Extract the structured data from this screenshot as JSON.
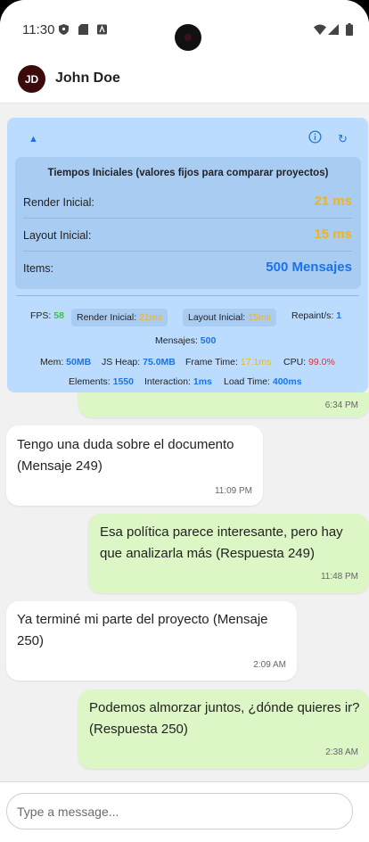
{
  "status_bar": {
    "time": "11:30",
    "icons": [
      "shield-icon",
      "sd-card-icon",
      "app-notification-icon",
      "wifi-icon",
      "signal-icon",
      "battery-icon"
    ]
  },
  "header": {
    "avatar_initials": "JD",
    "avatar_color": "#3c0a0a",
    "contact_name": "John Doe"
  },
  "perf_panel": {
    "collapse_icon": "▲",
    "info_icon": "info-icon",
    "refresh_icon": "↻",
    "initial_times": {
      "title": "Tiempos Iniciales (valores fijos para comparar proyectos)",
      "rows": [
        {
          "label": "Render Inicial:",
          "value": "21 ms"
        },
        {
          "label": "Layout Inicial:",
          "value": "15 ms"
        },
        {
          "label": "Items:",
          "value": "500 Mensajes"
        }
      ]
    },
    "stats": {
      "fps_label": "FPS:",
      "fps_value": "58",
      "render_label": "Render Inicial:",
      "render_value": "21ms",
      "layout_label": "Layout Inicial:",
      "layout_value": "15ms",
      "repaint_label": "Repaint/s:",
      "repaint_value": "1",
      "messages_label": "Mensajes:",
      "messages_value": "500",
      "mem_label": "Mem:",
      "mem_value": "50MB",
      "heap_label": "JS Heap:",
      "heap_value": "75.0MB",
      "frame_label": "Frame Time:",
      "frame_value": "17.1ms",
      "cpu_label": "CPU:",
      "cpu_value": "99.0%",
      "elements_label": "Elements:",
      "elements_value": "1550",
      "interaction_label": "Interaction:",
      "interaction_value": "1ms",
      "load_label": "Load Time:",
      "load_value": "400ms"
    },
    "colors": {
      "panel": "#bcdcff",
      "good": "#3fbf4a",
      "warn": "#f2b417",
      "info": "#1a73e8",
      "bad": "#e03030"
    }
  },
  "messages": [
    {
      "type": "outgoing",
      "text": "",
      "time": "6:34 PM"
    },
    {
      "type": "incoming",
      "text": "Tengo una duda sobre el documento (Mensaje 249)",
      "time": "11:09 PM"
    },
    {
      "type": "outgoing",
      "text": "Esa política parece interesante, pero hay que analizarla más (Respuesta 249)",
      "time": "11:48 PM"
    },
    {
      "type": "incoming",
      "text": "Ya terminé mi parte del proyecto (Mensaje 250)",
      "time": "2:09 AM"
    },
    {
      "type": "outgoing",
      "text": "Podemos almorzar juntos, ¿dónde quieres ir? (Respuesta 250)",
      "time": "2:38 AM"
    }
  ],
  "composer": {
    "placeholder": "Type a message..."
  }
}
